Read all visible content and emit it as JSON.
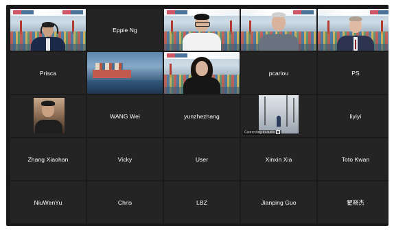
{
  "window": {
    "background": "#1a1a1a",
    "active_speaker_color": "#b9dc3a"
  },
  "participants": [
    {
      "name": "",
      "video": true,
      "kind": "speaker-headphones"
    },
    {
      "name": "Eppie Ng",
      "video": false
    },
    {
      "name": "",
      "video": true,
      "kind": "man-glasses"
    },
    {
      "name": "",
      "video": true,
      "kind": "man-grey"
    },
    {
      "name": "",
      "video": true,
      "kind": "man-suit"
    },
    {
      "name": "Prisca",
      "video": false
    },
    {
      "name": "",
      "video": true,
      "kind": "ship"
    },
    {
      "name": "",
      "video": true,
      "kind": "woman"
    },
    {
      "name": "pcariou",
      "video": false
    },
    {
      "name": "PS",
      "video": false
    },
    {
      "name": "",
      "video": true,
      "kind": "man-room"
    },
    {
      "name": "WANG Wei",
      "video": false
    },
    {
      "name": "yunzhezhang",
      "video": false
    },
    {
      "name": "",
      "video": true,
      "kind": "snow",
      "status": "Connecting to audio"
    },
    {
      "name": "liyiyi",
      "video": false
    },
    {
      "name": "Zhang Xiaohan",
      "video": false
    },
    {
      "name": "Vicky",
      "video": false
    },
    {
      "name": "User",
      "video": false
    },
    {
      "name": "Xinxin Xia",
      "video": false
    },
    {
      "name": "Toto Kwan",
      "video": false
    },
    {
      "name": "NiuWenYu",
      "video": false
    },
    {
      "name": "Chris",
      "video": false
    },
    {
      "name": "LBZ",
      "video": false
    },
    {
      "name": "Jianping Guo",
      "video": false
    },
    {
      "name": "翟晓杰",
      "video": false
    }
  ]
}
